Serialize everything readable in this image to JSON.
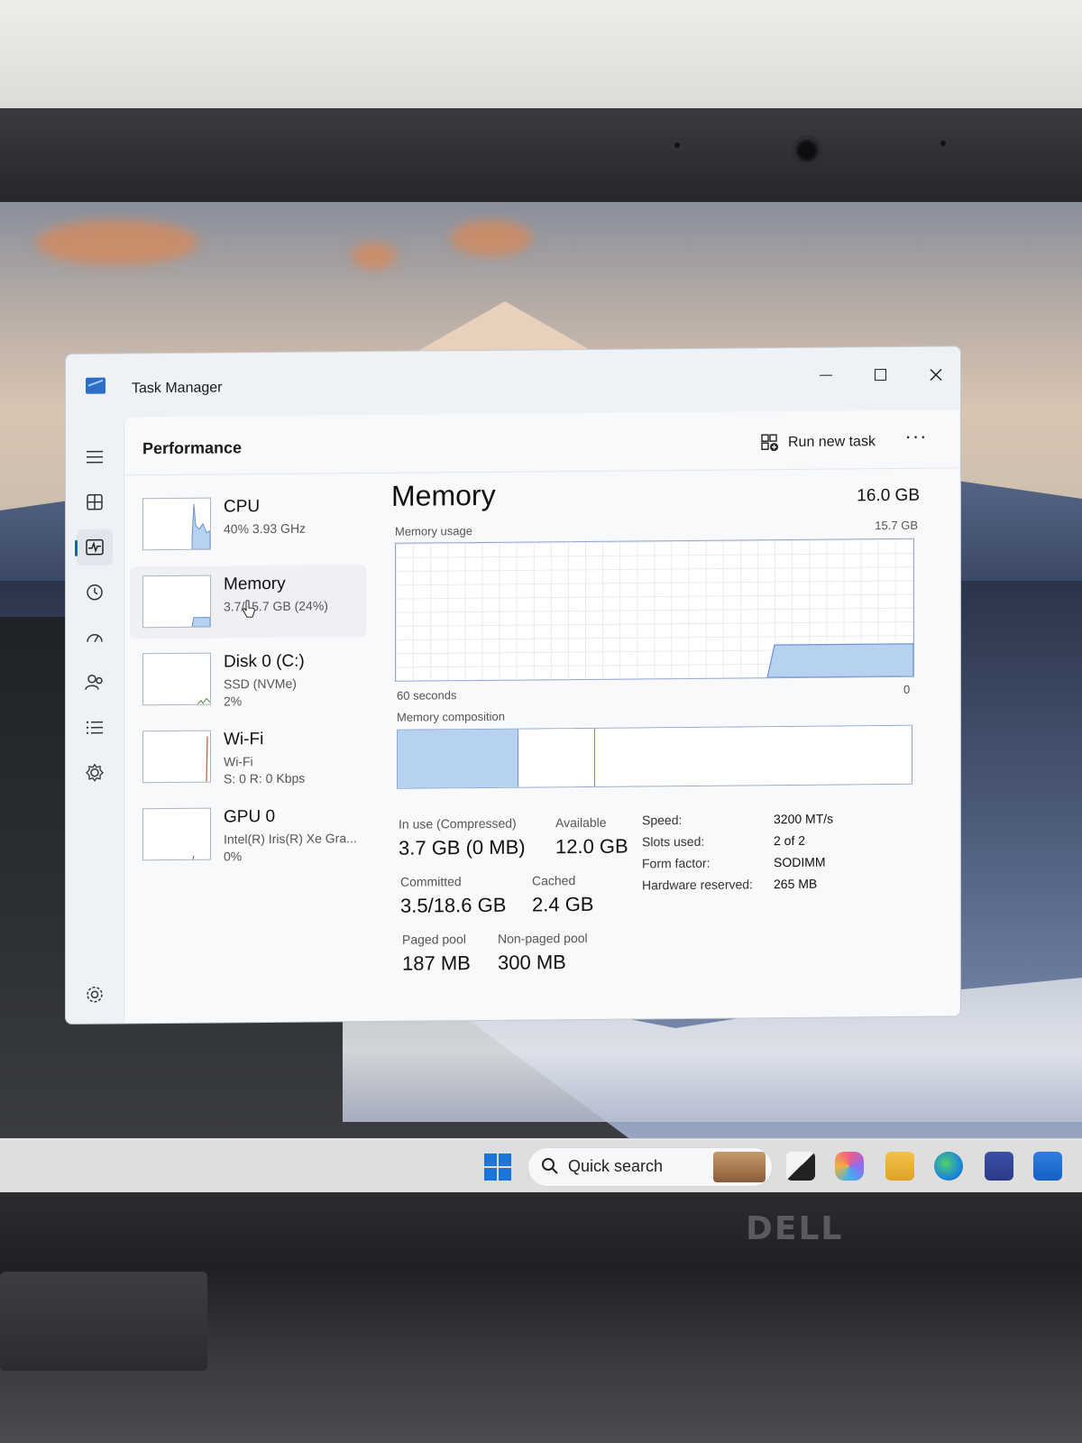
{
  "window": {
    "title": "Task Manager"
  },
  "header": {
    "page_title": "Performance",
    "run_new_task_label": "Run new task",
    "more_label": "···"
  },
  "nav": [
    {
      "icon": "hamburger-menu-icon"
    },
    {
      "icon": "processes-icon"
    },
    {
      "icon": "performance-icon",
      "active": true
    },
    {
      "icon": "app-history-icon"
    },
    {
      "icon": "startup-apps-icon"
    },
    {
      "icon": "users-icon"
    },
    {
      "icon": "details-icon"
    },
    {
      "icon": "services-icon"
    },
    {
      "icon": "settings-icon"
    }
  ],
  "perf_items": [
    {
      "name": "CPU",
      "line1": "40%  3.93 GHz",
      "line2": ""
    },
    {
      "name": "Memory",
      "line1": "3.7/15.7 GB (24%)",
      "line2": "",
      "selected": true
    },
    {
      "name": "Disk 0 (C:)",
      "line1": "SSD (NVMe)",
      "line2": "2%"
    },
    {
      "name": "Wi-Fi",
      "line1": "Wi-Fi",
      "line2": "S: 0  R: 0 Kbps"
    },
    {
      "name": "GPU 0",
      "line1": "Intel(R) Iris(R) Xe Gra...",
      "line2": "0%"
    }
  ],
  "memory": {
    "title": "Memory",
    "total": "16.0 GB",
    "usage_label": "Memory usage",
    "usage_max": "15.7 GB",
    "time_left": "60 seconds",
    "time_right": "0",
    "composition_label": "Memory composition",
    "composition_fractions": [
      0.235,
      0.147,
      0.618
    ],
    "stats": {
      "in_use_label": "In use (Compressed)",
      "in_use_value": "3.7 GB (0 MB)",
      "available_label": "Available",
      "available_value": "12.0 GB",
      "committed_label": "Committed",
      "committed_value": "3.5/18.6 GB",
      "cached_label": "Cached",
      "cached_value": "2.4 GB",
      "paged_label": "Paged pool",
      "paged_value": "187 MB",
      "nonpaged_label": "Non-paged pool",
      "nonpaged_value": "300 MB"
    },
    "specs": {
      "speed_label": "Speed:",
      "speed_value": "3200 MT/s",
      "slots_label": "Slots used:",
      "slots_value": "2 of 2",
      "form_label": "Form factor:",
      "form_value": "SODIMM",
      "reserved_label": "Hardware reserved:",
      "reserved_value": "265 MB"
    }
  },
  "taskbar": {
    "search_label": "Quick search"
  },
  "brand": "DELL",
  "colors": {
    "accent": "#1a5fb4",
    "memory_fill": "#b7d1f1",
    "memory_line": "#6c93cf"
  }
}
